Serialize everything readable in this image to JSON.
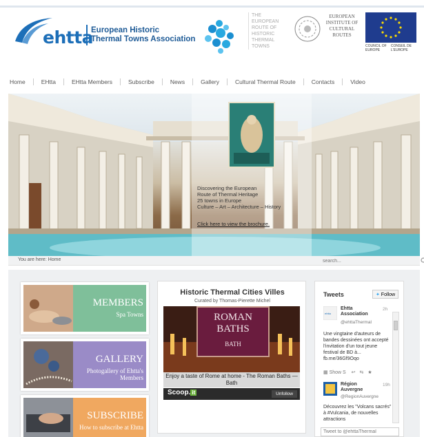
{
  "header": {
    "logo_word": "ehtta",
    "association_line1": "European Historic",
    "association_line2": "Thermal Towns Association",
    "route_text": "THE EUROPEAN ROUTE OF HISTORIC THERMAL TOWNS",
    "institute_text": "EUROPEAN INSTITUTE OF CULTURAL ROUTES",
    "coe_left": "COUNCIL OF EUROPE",
    "coe_right": "CONSEIL DE L'EUROPE",
    "brand_color": "#1d6fb8"
  },
  "nav": {
    "items": [
      "Home",
      "EHtta",
      "EHtta Members",
      "Subscribe",
      "News",
      "Gallery",
      "Cultural Thermal Route",
      "Contacts",
      "Video"
    ]
  },
  "hero": {
    "line1": "Discovering the European",
    "line2": "Route of Thermal Heritage",
    "line3": "25 towns in Europe",
    "line4": "Culture – Art – Architecture – History",
    "link": "Click here to view the brochure."
  },
  "breadcrumb": {
    "text": "You are here: Home"
  },
  "search": {
    "placeholder": "search..."
  },
  "promos": [
    {
      "title": "MEMBERS",
      "subtitle": "Spa Towns",
      "color": "#7fbf9a"
    },
    {
      "title": "GALLERY",
      "subtitle": "Photogallery of Ehtta's Members",
      "color": "#9a8bc7"
    },
    {
      "title": "SUBSCRIBE",
      "subtitle": "How to subscribe at Ehtta",
      "color": "#f0a860"
    }
  ],
  "scoop": {
    "title": "Historic Thermal Cities Villes",
    "curator": "Curated by Thomas-Pierette Michel",
    "sign_line1": "ROMAN",
    "sign_line2": "BATHS",
    "sign_sub": "BATH",
    "headline": "Enjoy a taste of Rome at home - The Roman Baths — Bath",
    "brand": "Scoop.",
    "brand_badge": "it",
    "unfollow": "Unfollow"
  },
  "twitter": {
    "title": "Tweets",
    "follow": "Follow",
    "tweets": [
      {
        "name": "Ehtta Association",
        "handle": "@ehttaThermal",
        "time": "2h",
        "text": "Une vingtaine d'auteurs de bandes dessinées ont accepté l'invitation d'un tout jeune festival de BD à... fb.me/36Gf9Oqo",
        "actions": "Show S"
      },
      {
        "name": "Région Auvergne",
        "handle": "@RegionAuvergne",
        "time": "19h",
        "text": "Découvrez les \"Volcans sacrés\" à #Vulcania, de nouvelles attractions"
      }
    ],
    "compose_placeholder": "Tweet to @ehttaThermal"
  }
}
